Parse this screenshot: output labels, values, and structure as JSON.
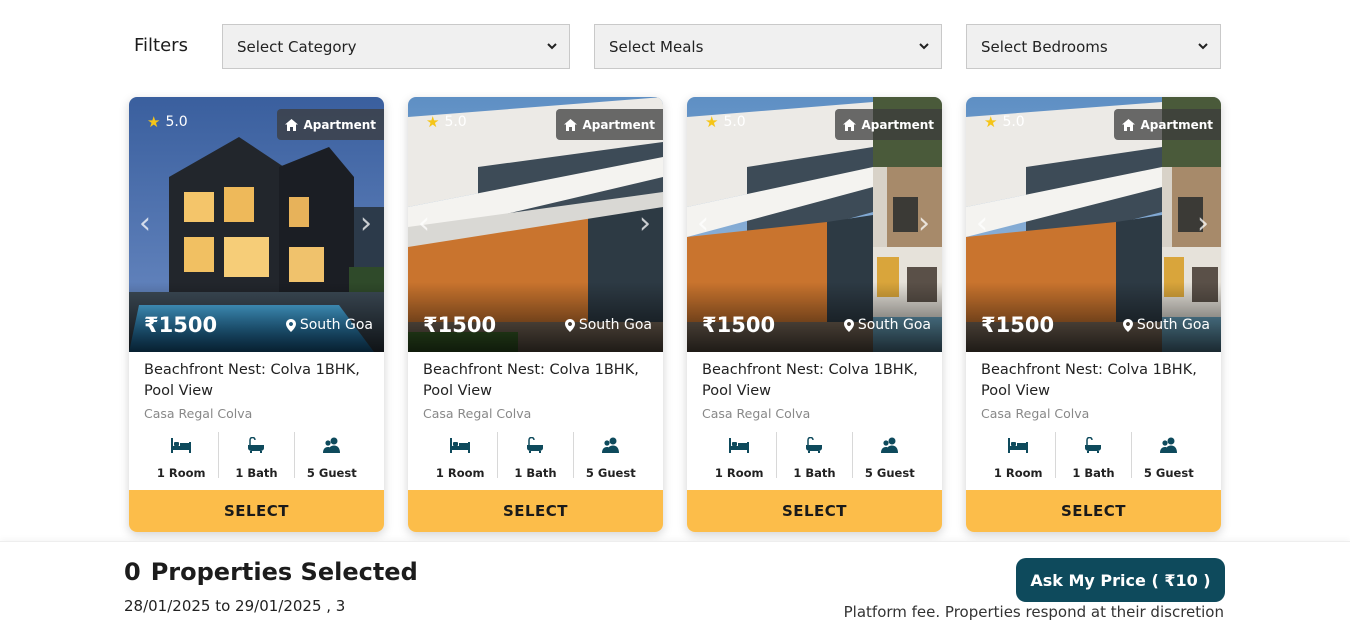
{
  "filters": {
    "label": "Filters",
    "category": "Select Category",
    "meals": "Select Meals",
    "bedrooms": "Select Bedrooms"
  },
  "cards": [
    {
      "rating": "5.0",
      "type": "Apartment",
      "price": "₹1500",
      "location": "South Goa",
      "title": "Beachfront Nest: Colva 1BHK, Pool View",
      "subtitle": "Casa Regal Colva",
      "rooms": "1 Room",
      "baths": "1 Bath",
      "guests": "5 Guest",
      "button": "SELECT"
    },
    {
      "rating": "5.0",
      "type": "Apartment",
      "price": "₹1500",
      "location": "South Goa",
      "title": "Beachfront Nest: Colva 1BHK, Pool View",
      "subtitle": "Casa Regal Colva",
      "rooms": "1 Room",
      "baths": "1 Bath",
      "guests": "5 Guest",
      "button": "SELECT"
    },
    {
      "rating": "5.0",
      "type": "Apartment",
      "price": "₹1500",
      "location": "South Goa",
      "title": "Beachfront Nest: Colva 1BHK, Pool View",
      "subtitle": "Casa Regal Colva",
      "rooms": "1 Room",
      "baths": "1 Bath",
      "guests": "5 Guest",
      "button": "SELECT"
    },
    {
      "rating": "5.0",
      "type": "Apartment",
      "price": "₹1500",
      "location": "South Goa",
      "title": "Beachfront Nest: Colva 1BHK, Pool View",
      "subtitle": "Casa Regal Colva",
      "rooms": "1 Room",
      "baths": "1 Bath",
      "guests": "5 Guest",
      "button": "SELECT"
    }
  ],
  "footer": {
    "count": "0",
    "selected_label": "Properties Selected",
    "dates": "28/01/2025 to 29/01/2025 , 3",
    "ask_button": "Ask My Price ( ₹10 )",
    "fee_note": "Platform fee. Properties respond at their discretion"
  },
  "colors": {
    "accent": "#fcbd4a",
    "primary": "#0e4a5c",
    "icon": "#0e4a5c"
  }
}
